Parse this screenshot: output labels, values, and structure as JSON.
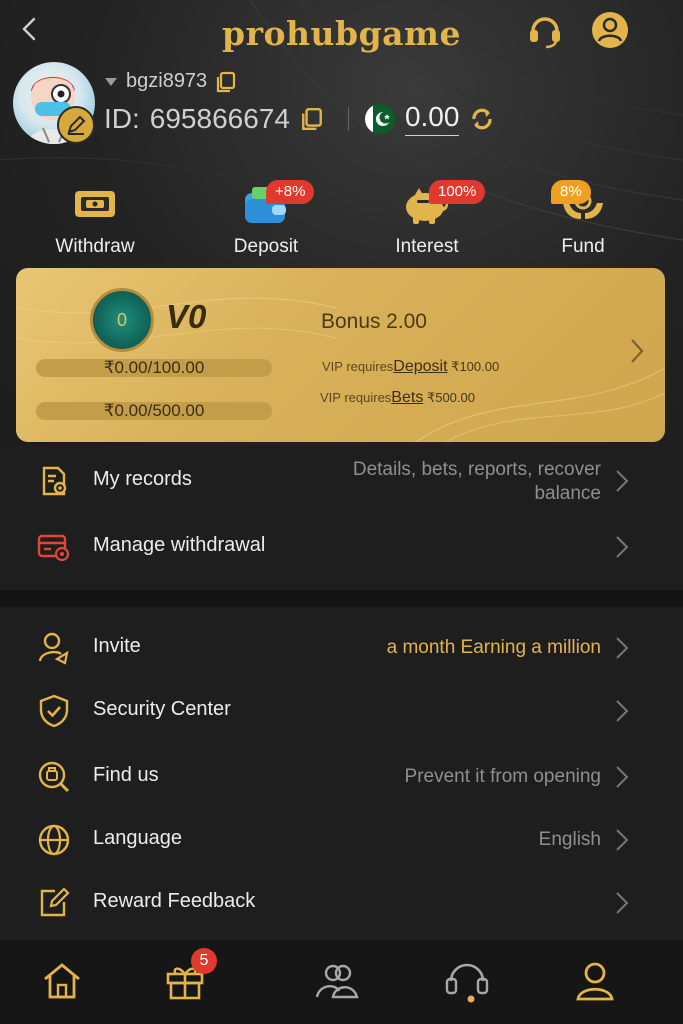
{
  "header": {
    "title": "prohubgame",
    "back_icon": "chevron-left-icon",
    "support_icon": "headset-icon",
    "profile_icon": "user-circle-icon"
  },
  "profile": {
    "username": "bgzi8973",
    "id_label": "ID:",
    "id_value": "695866674",
    "balance": "0.00"
  },
  "quick_actions": [
    {
      "label": "Withdraw",
      "badge": "",
      "icon": "withdraw-icon"
    },
    {
      "label": "Deposit",
      "badge": "+8%",
      "icon": "wallet-icon"
    },
    {
      "label": "Interest",
      "badge": "100%",
      "icon": "piggy-bank-icon"
    },
    {
      "label": "Fund",
      "badge": "8%",
      "icon": "hands-coin-icon"
    }
  ],
  "vip": {
    "badge_level": "0",
    "level": "V0",
    "bonus_label": "Bonus",
    "bonus_value": "2.00",
    "deposit_progress": "₹0.00/100.00",
    "bet_progress": "₹0.00/500.00",
    "deposit_req_prefix": "VIP requires",
    "deposit_req_link": "Deposit",
    "deposit_req_amount": "₹100.00",
    "bet_req_prefix": "VIP requires",
    "bet_req_link": "Bets",
    "bet_req_amount": "₹500.00"
  },
  "menu_primary": [
    {
      "label": "My records",
      "desc": "Details, bets, reports, recover balance",
      "icon": "records-icon"
    },
    {
      "label": "Manage withdrawal",
      "desc": "",
      "icon": "card-settings-icon"
    }
  ],
  "menu_secondary": [
    {
      "label": "Invite",
      "desc": "a month Earning a million",
      "icon": "invite-user-icon"
    },
    {
      "label": "Security Center",
      "desc": "",
      "icon": "shield-check-icon"
    },
    {
      "label": "Find us",
      "desc": "Prevent it from opening",
      "icon": "find-us-icon"
    },
    {
      "label": "Language",
      "desc": "English",
      "icon": "globe-icon"
    },
    {
      "label": "Reward Feedback",
      "desc": "",
      "icon": "edit-note-icon"
    }
  ],
  "tabbar": {
    "gift_badge": "5",
    "tabs": [
      "home-icon",
      "gift-icon",
      "community-icon",
      "support-icon",
      "profile-icon"
    ]
  },
  "colors": {
    "gold": "#e2b44a",
    "card_gold": "#d9b15a",
    "invite_desc": "#e2b44a",
    "badge_red": "#e0392d",
    "badge_orange": "#f0a020"
  }
}
